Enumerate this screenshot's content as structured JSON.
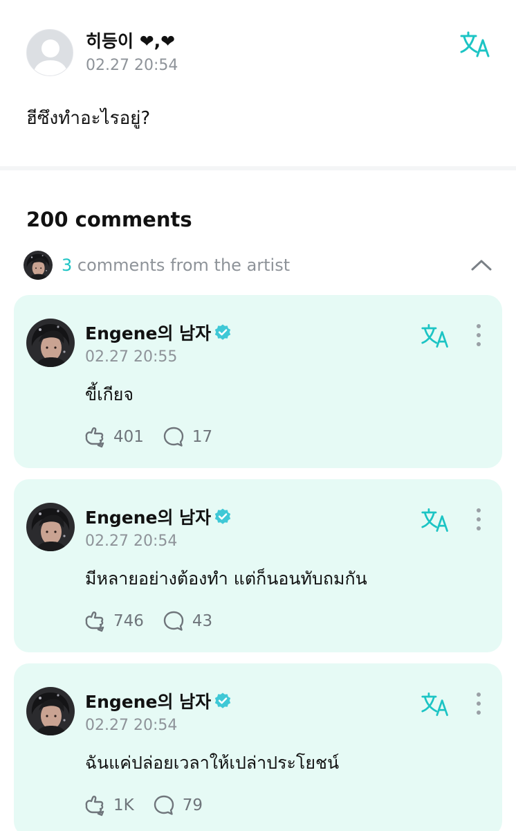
{
  "post": {
    "author": "히등이 ❤,❤",
    "timestamp": "02.27 20:54",
    "body": "ฮีซึงทำอะไรอยู่?"
  },
  "comments_header": {
    "title": "200 comments",
    "artist_count": "3",
    "artist_label": " comments from the artist"
  },
  "comments": [
    {
      "author": "Engene의 남자",
      "timestamp": "02.27 20:55",
      "body": "ขี้เกียจ",
      "likes": "401",
      "replies": "17"
    },
    {
      "author": "Engene의 남자",
      "timestamp": "02.27 20:54",
      "body": "มีหลายอย่างต้องทำ แต่ก็นอนทับถมกัน",
      "likes": "746",
      "replies": "43"
    },
    {
      "author": "Engene의 남자",
      "timestamp": "02.27 20:54",
      "body": "ฉันแค่ปล่อยเวลาให้เปล่าประโยชน์",
      "likes": "1K",
      "replies": "79"
    }
  ],
  "icons": {
    "translate": "translate-icon",
    "more": "more-vertical-icon",
    "like": "like-hand-icon",
    "reply": "comment-bubble-icon",
    "verified": "verified-badge-icon",
    "collapse": "chevron-up-icon"
  },
  "colors": {
    "accent": "#1cc4c4",
    "card_bg": "#e6faf5",
    "muted_text": "#8e9399"
  }
}
